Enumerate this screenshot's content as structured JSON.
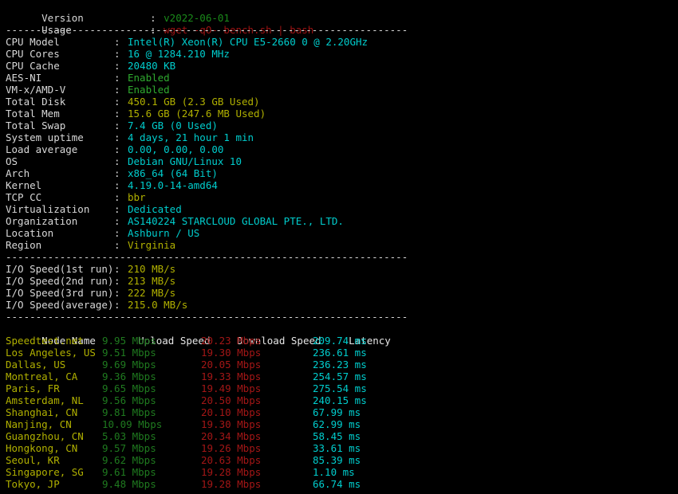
{
  "terminal": {
    "background": "#000000",
    "foreground": "#d8d8d8",
    "colors": {
      "cyan": "#00cdcd",
      "green": "#1a8a1a",
      "red": "#9e1414",
      "yellow": "#b0b000",
      "white": "#d8d8d8"
    },
    "separator": "-------------------------------------------------------------------"
  },
  "header": {
    "rows": [
      {
        "label": "Version",
        "colon": ":",
        "value": "v2022-06-01",
        "color": "green"
      },
      {
        "label": "Usage",
        "colon": ":",
        "value": "wget -qO- bench.sh | bash",
        "color": "red"
      }
    ]
  },
  "system": {
    "rows": [
      {
        "label": "CPU Model",
        "colon": ":",
        "value": "Intel(R) Xeon(R) CPU E5-2660 0 @ 2.20GHz",
        "color": "cyan"
      },
      {
        "label": "CPU Cores",
        "colon": ":",
        "value": "16 @ 1284.210 MHz",
        "color": "cyan"
      },
      {
        "label": "CPU Cache",
        "colon": ":",
        "value": "20480 KB",
        "color": "cyan"
      },
      {
        "label": "AES-NI",
        "colon": ":",
        "value": "Enabled",
        "color": "lgreen"
      },
      {
        "label": "VM-x/AMD-V",
        "colon": ":",
        "value": "Enabled",
        "color": "lgreen"
      },
      {
        "label": "Total Disk",
        "colon": ":",
        "value": "450.1 GB (2.3 GB Used)",
        "color": "yellow"
      },
      {
        "label": "Total Mem",
        "colon": ":",
        "value": "15.6 GB (247.6 MB Used)",
        "color": "yellow"
      },
      {
        "label": "Total Swap",
        "colon": ":",
        "value": "7.4 GB (0 Used)",
        "color": "cyan"
      },
      {
        "label": "System uptime",
        "colon": ":",
        "value": "4 days, 21 hour 1 min",
        "color": "cyan"
      },
      {
        "label": "Load average",
        "colon": ":",
        "value": "0.00, 0.00, 0.00",
        "color": "cyan"
      },
      {
        "label": "OS",
        "colon": ":",
        "value": "Debian GNU/Linux 10",
        "color": "cyan"
      },
      {
        "label": "Arch",
        "colon": ":",
        "value": "x86_64 (64 Bit)",
        "color": "cyan"
      },
      {
        "label": "Kernel",
        "colon": ":",
        "value": "4.19.0-14-amd64",
        "color": "cyan"
      },
      {
        "label": "TCP CC",
        "colon": ":",
        "value": "bbr",
        "color": "yellow"
      },
      {
        "label": "Virtualization",
        "colon": ":",
        "value": "Dedicated",
        "color": "cyan"
      },
      {
        "label": "Organization",
        "colon": ":",
        "value": "AS140224 STARCLOUD GLOBAL PTE., LTD.",
        "color": "cyan"
      },
      {
        "label": "Location",
        "colon": ":",
        "value": "Ashburn / US",
        "color": "cyan"
      },
      {
        "label": "Region",
        "colon": ":",
        "value": "Virginia",
        "color": "yellow"
      }
    ]
  },
  "io": {
    "rows": [
      {
        "label": "I/O Speed(1st run)",
        "colon": ":",
        "value": "210 MB/s",
        "color": "yellow"
      },
      {
        "label": "I/O Speed(2nd run)",
        "colon": ":",
        "value": "213 MB/s",
        "color": "yellow"
      },
      {
        "label": "I/O Speed(3rd run)",
        "colon": ":",
        "value": "222 MB/s",
        "color": "yellow"
      },
      {
        "label": "I/O Speed(average)",
        "colon": ":",
        "value": "215.0 MB/s",
        "color": "yellow"
      }
    ]
  },
  "speedtest": {
    "columns": {
      "node": "Node Name",
      "upload": "Upload Speed",
      "download": "Download Speed",
      "latency": "Latency"
    },
    "rows": [
      {
        "node": "Speedtest.net",
        "upload": "9.95 Mbps",
        "download": "20.23 Mbps",
        "latency": "209.74 ms"
      },
      {
        "node": "Los Angeles, US",
        "upload": "9.51 Mbps",
        "download": "19.30 Mbps",
        "latency": "236.61 ms"
      },
      {
        "node": "Dallas, US",
        "upload": "9.69 Mbps",
        "download": "20.05 Mbps",
        "latency": "236.23 ms"
      },
      {
        "node": "Montreal, CA",
        "upload": "9.36 Mbps",
        "download": "19.33 Mbps",
        "latency": "254.57 ms"
      },
      {
        "node": "Paris, FR",
        "upload": "9.65 Mbps",
        "download": "19.49 Mbps",
        "latency": "275.54 ms"
      },
      {
        "node": "Amsterdam, NL",
        "upload": "9.56 Mbps",
        "download": "20.50 Mbps",
        "latency": "240.15 ms"
      },
      {
        "node": "Shanghai, CN",
        "upload": "9.81 Mbps",
        "download": "20.10 Mbps",
        "latency": "67.99 ms"
      },
      {
        "node": "Nanjing, CN",
        "upload": "10.09 Mbps",
        "download": "19.30 Mbps",
        "latency": "62.99 ms"
      },
      {
        "node": "Guangzhou, CN",
        "upload": "5.03 Mbps",
        "download": "20.34 Mbps",
        "latency": "58.45 ms"
      },
      {
        "node": "Hongkong, CN",
        "upload": "9.57 Mbps",
        "download": "19.26 Mbps",
        "latency": "33.61 ms"
      },
      {
        "node": "Seoul, KR",
        "upload": "9.62 Mbps",
        "download": "20.63 Mbps",
        "latency": "85.39 ms"
      },
      {
        "node": "Singapore, SG",
        "upload": "9.61 Mbps",
        "download": "19.28 Mbps",
        "latency": "1.10 ms"
      },
      {
        "node": "Tokyo, JP",
        "upload": "9.48 Mbps",
        "download": "19.28 Mbps",
        "latency": "66.74 ms"
      }
    ]
  }
}
